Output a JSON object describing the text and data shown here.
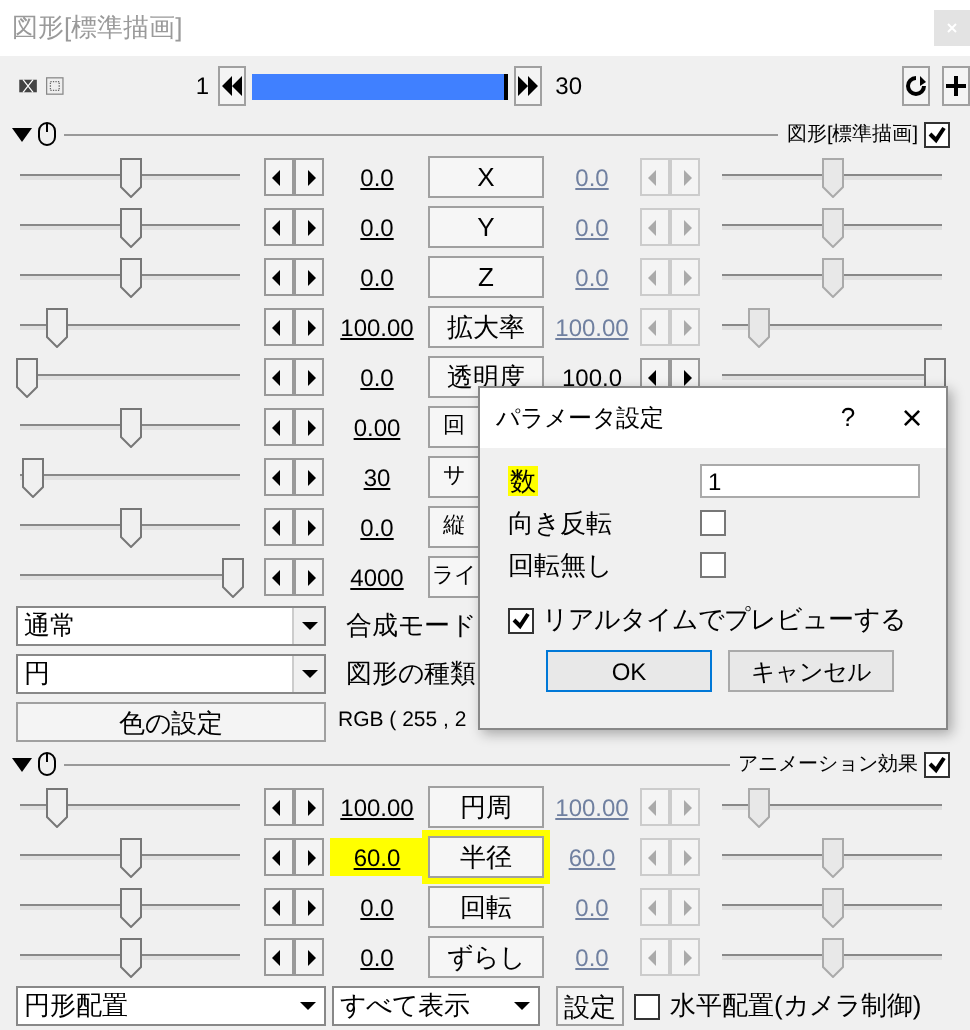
{
  "window": {
    "title": "図形[標準描画]"
  },
  "timeline": {
    "start": "1",
    "end": "30",
    "level": 1
  },
  "sections": [
    {
      "title": "図形[標準描画]",
      "checked": true,
      "rows": [
        {
          "label": "X",
          "value": "0.0",
          "level": 0.5,
          "right": {
            "value": "0.0",
            "enabled": false,
            "level": 0.5
          }
        },
        {
          "label": "Y",
          "value": "0.0",
          "level": 0.5,
          "right": {
            "value": "0.0",
            "enabled": false,
            "level": 0.5
          }
        },
        {
          "label": "Z",
          "value": "0.0",
          "level": 0.5,
          "right": {
            "value": "0.0",
            "enabled": false,
            "level": 0.5
          }
        },
        {
          "label": "拡大率",
          "value": "100.00",
          "level": 0.15,
          "right": {
            "value": "100.00",
            "enabled": false,
            "level": 0.15
          }
        },
        {
          "label": "透明度",
          "value": "0.0",
          "level": 0,
          "right": {
            "value": "100.0",
            "enabled": true,
            "level": 1
          }
        },
        {
          "label": "回",
          "value": "0.00",
          "level": 0.5
        },
        {
          "label": "サ",
          "value": "30",
          "level": 0.03
        },
        {
          "label": "縦",
          "value": "0.0",
          "level": 0.5
        },
        {
          "label": "ライ",
          "value": "4000",
          "level": 1
        }
      ],
      "controls": [
        {
          "kind": "select",
          "value": "通常",
          "label": "合成モード"
        },
        {
          "kind": "select",
          "value": "円",
          "label": "図形の種類"
        },
        {
          "kind": "button",
          "value": "色の設定",
          "label": "RGB ( 255 , 2"
        }
      ]
    },
    {
      "title": "アニメーション効果",
      "checked": true,
      "rows": [
        {
          "label": "円周",
          "value": "100.00",
          "level": 0.15,
          "right": {
            "value": "100.00",
            "enabled": false,
            "level": 0.15
          }
        },
        {
          "label": "半径",
          "value": "60.0",
          "level": 0.5,
          "highlighted": true,
          "right": {
            "value": "60.0",
            "enabled": false,
            "level": 0.5
          }
        },
        {
          "label": "回転",
          "value": "0.0",
          "level": 0.5,
          "right": {
            "value": "0.0",
            "enabled": false,
            "level": 0.5
          }
        },
        {
          "label": "ずらし",
          "value": "0.0",
          "level": 0.5,
          "right": {
            "value": "0.0",
            "enabled": false,
            "level": 0.5
          }
        }
      ]
    }
  ],
  "bottom": {
    "select_1": "円形配置",
    "select_2": "すべて表示",
    "button": "設定",
    "checkbox": {
      "label": "水平配置(カメラ制御)",
      "checked": false
    }
  },
  "dialog": {
    "title": "パラメータ設定",
    "help": "?",
    "close": "×",
    "fields": [
      {
        "kind": "input",
        "label": "数",
        "value": "1",
        "highlighted": true
      },
      {
        "kind": "checkbox",
        "label": "向き反転",
        "checked": false
      },
      {
        "kind": "checkbox",
        "label": "回転無し",
        "checked": false
      }
    ],
    "preview": {
      "label": "リアルタイムでプレビューする",
      "checked": true
    },
    "buttons": [
      "OK",
      "キャンセル"
    ]
  }
}
